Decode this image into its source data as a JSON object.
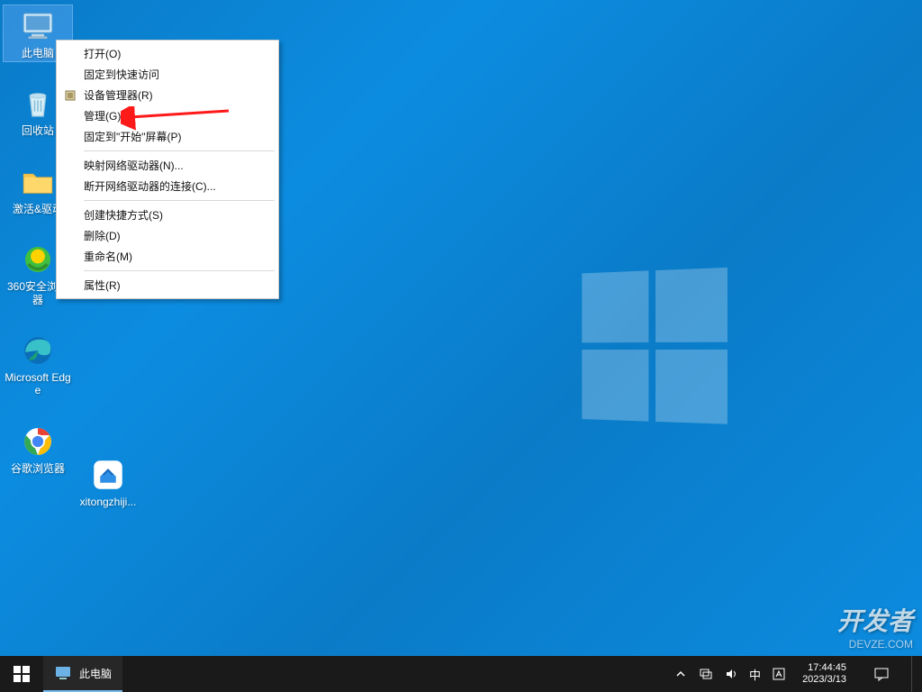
{
  "desktop_icons": [
    {
      "id": "this-pc",
      "label": "此电脑",
      "selected": true
    },
    {
      "id": "recycle-bin",
      "label": "回收站"
    },
    {
      "id": "drivers-folder",
      "label": "激活&驱动"
    },
    {
      "id": "360-browser",
      "label": "360安全浏览器"
    },
    {
      "id": "edge",
      "label": "Microsoft Edge"
    },
    {
      "id": "chrome",
      "label": "谷歌浏览器"
    }
  ],
  "desktop_icon_row2": {
    "id": "xitongzhiji",
    "label": "xitongzhiji..."
  },
  "context_menu": {
    "items": [
      {
        "key": "open",
        "label": "打开(O)"
      },
      {
        "key": "pin-quick",
        "label": "固定到快速访问"
      },
      {
        "key": "device-manager",
        "label": "设备管理器(R)",
        "icon": "chip"
      },
      {
        "key": "manage",
        "label": "管理(G)",
        "highlighted": true
      },
      {
        "key": "pin-start",
        "label": "固定到\"开始\"屏幕(P)"
      },
      {
        "sep": true
      },
      {
        "key": "map-drive",
        "label": "映射网络驱动器(N)..."
      },
      {
        "key": "disconnect-drive",
        "label": "断开网络驱动器的连接(C)..."
      },
      {
        "sep": true
      },
      {
        "key": "shortcut",
        "label": "创建快捷方式(S)"
      },
      {
        "key": "delete",
        "label": "删除(D)"
      },
      {
        "key": "rename",
        "label": "重命名(M)"
      },
      {
        "sep": true
      },
      {
        "key": "properties",
        "label": "属性(R)"
      }
    ]
  },
  "taskbar": {
    "task_label": "此电脑",
    "ime": "中",
    "time": "17:44:45",
    "date": "2023/3/13"
  },
  "watermark": {
    "text": "开发者",
    "sub": "DEVZE.COM"
  }
}
